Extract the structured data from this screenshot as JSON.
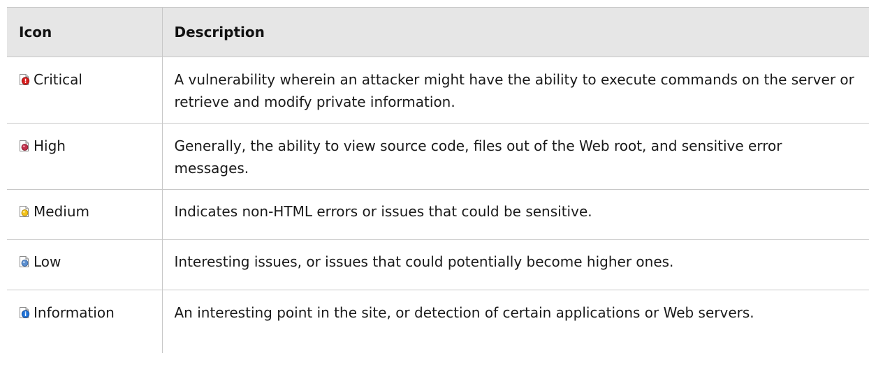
{
  "table": {
    "header": {
      "icon": "Icon",
      "description": "Description"
    },
    "rows": [
      {
        "label": "Critical",
        "icon": "critical-icon",
        "icon_color": "#d81e1e",
        "description": "A vulnerability wherein an attacker might have the ability to execute commands on the server or retrieve and modify private information."
      },
      {
        "label": "High",
        "icon": "high-icon",
        "icon_color": "#c0304a",
        "description": "Generally, the ability to view source code, files out of the Web root, and sensitive error messages."
      },
      {
        "label": "Medium",
        "icon": "medium-icon",
        "icon_color": "#f2c21a",
        "description": "Indicates non-HTML errors or issues that could be sensitive."
      },
      {
        "label": "Low",
        "icon": "low-icon",
        "icon_color": "#5c8fcf",
        "description": "Interesting issues, or issues that could potentially become higher ones."
      },
      {
        "label": "Information",
        "icon": "information-icon",
        "icon_color": "#1f73d8",
        "description": "An interesting point in the site, or detection of certain applications or Web servers."
      }
    ]
  }
}
